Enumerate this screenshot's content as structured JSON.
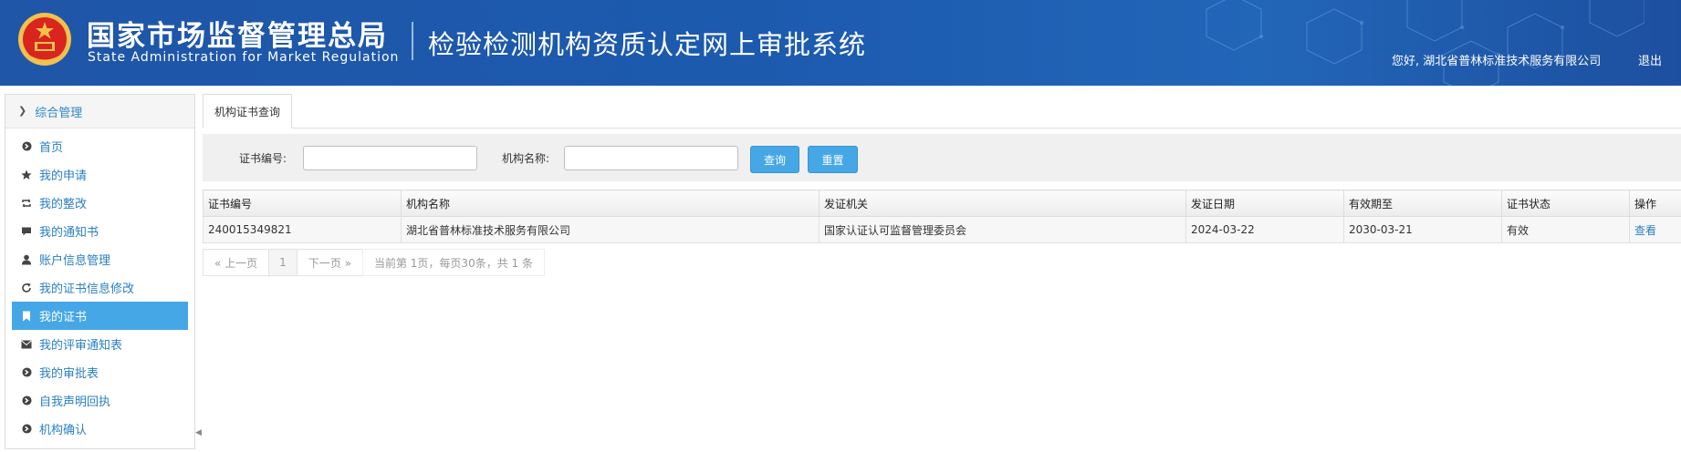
{
  "header": {
    "org_cn": "国家市场监督管理总局",
    "org_en": "State Administration  for  Market Regulation",
    "system_title": "检验检测机构资质认定网上审批系统",
    "user_greeting": "您好, 湖北省普林标准技术服务有限公司",
    "logout_label": "退出"
  },
  "colors": {
    "header_bg": "#1f56a8",
    "accent": "#45a7e6",
    "link": "#2a7fc2",
    "emblem_red": "#d8251d",
    "emblem_gold": "#f2c14e"
  },
  "sidebar": {
    "section_title": "综合管理",
    "items": [
      {
        "label": "首页",
        "icon": "arrow-circle-icon",
        "active": false
      },
      {
        "label": "我的申请",
        "icon": "star-icon",
        "active": false
      },
      {
        "label": "我的整改",
        "icon": "retweet-icon",
        "active": false
      },
      {
        "label": "我的通知书",
        "icon": "comment-icon",
        "active": false
      },
      {
        "label": "账户信息管理",
        "icon": "user-icon",
        "active": false
      },
      {
        "label": "我的证书信息修改",
        "icon": "refresh-icon",
        "active": false
      },
      {
        "label": "我的证书",
        "icon": "bookmark-icon",
        "active": true
      },
      {
        "label": "我的评审通知表",
        "icon": "envelope-icon",
        "active": false
      },
      {
        "label": "我的审批表",
        "icon": "arrow-circle-icon",
        "active": false
      },
      {
        "label": "自我声明回执",
        "icon": "arrow-circle-icon",
        "active": false
      },
      {
        "label": "机构确认",
        "icon": "arrow-circle-icon",
        "active": false
      }
    ]
  },
  "tab": {
    "label": "机构证书查询"
  },
  "search": {
    "cert_no_label": "证书编号:",
    "cert_no_value": "",
    "org_name_label": "机构名称:",
    "org_name_value": "",
    "query_label": "查询",
    "reset_label": "重置"
  },
  "table": {
    "columns": [
      "证书编号",
      "机构名称",
      "发证机关",
      "发证日期",
      "有效期至",
      "证书状态",
      "操作"
    ],
    "rows": [
      {
        "cert_no": "240015349821",
        "org_name": "湖北省普林标准技术服务有限公司",
        "issuer": "国家认证认可监督管理委员会",
        "issue_date": "2024-03-22",
        "expire_date": "2030-03-21",
        "status": "有效",
        "action": "查看"
      }
    ]
  },
  "pager": {
    "prev_label": "« 上一页",
    "current_page": "1",
    "next_label": "下一页 »",
    "info": "当前第 1页，每页30条，共 1 条"
  }
}
